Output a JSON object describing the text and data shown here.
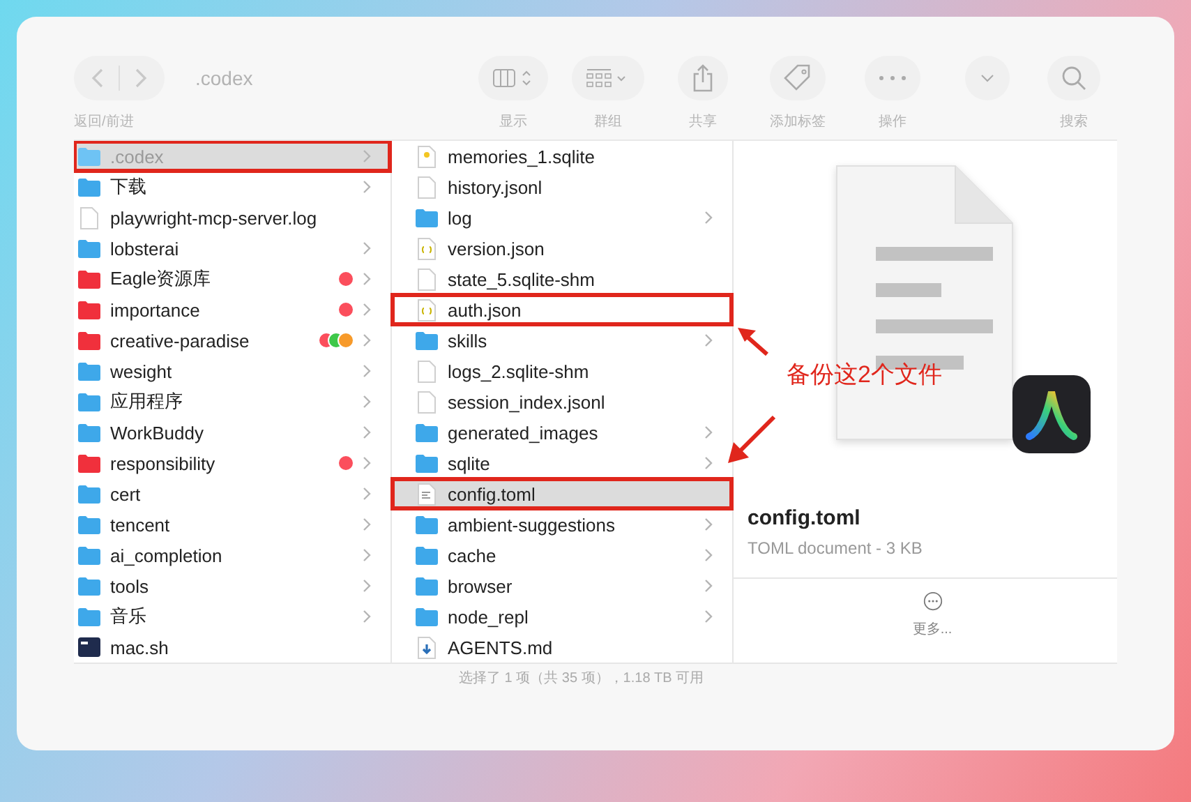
{
  "window": {
    "title": ".codex",
    "nav_label": "返回/前进"
  },
  "toolbar": [
    {
      "kind": "view",
      "label": "显示"
    },
    {
      "kind": "group",
      "label": "群组"
    },
    {
      "kind": "share",
      "label": "共享"
    },
    {
      "kind": "tag",
      "label": "添加标签"
    },
    {
      "kind": "action",
      "label": "操作"
    },
    {
      "kind": "more"
    },
    {
      "kind": "search",
      "label": "搜索"
    }
  ],
  "column_1": [
    {
      "name": ".codex",
      "kind": "folder",
      "color": "#6ec3f4",
      "selected": true,
      "highlighted": true,
      "has_children": true
    },
    {
      "name": "下载",
      "kind": "folder",
      "color": "#3ea8ea",
      "selected": false,
      "highlighted": false,
      "has_children": true
    },
    {
      "name": "playwright-mcp-server.log",
      "kind": "file",
      "selected": false,
      "highlighted": false,
      "has_children": false
    },
    {
      "name": "lobsterai",
      "kind": "folder",
      "color": "#3ea8ea",
      "selected": false,
      "highlighted": false,
      "has_children": true
    },
    {
      "name": "Eagle资源库",
      "kind": "folder",
      "color": "#f0303c",
      "selected": false,
      "highlighted": false,
      "has_children": true,
      "tags": [
        {
          "color": "#fb4e5c"
        }
      ]
    },
    {
      "name": "importance",
      "kind": "folder",
      "color": "#f0303c",
      "selected": false,
      "highlighted": false,
      "has_children": true,
      "tags": [
        {
          "color": "#fb4e5c"
        }
      ]
    },
    {
      "name": "creative-paradise",
      "kind": "folder",
      "color": "#f0303c",
      "selected": false,
      "highlighted": false,
      "has_children": true,
      "tags": [
        {
          "color": "#fb4e5c"
        },
        {
          "color": "#3ec84a"
        },
        {
          "color": "#f79a2a"
        }
      ]
    },
    {
      "name": "wesight",
      "kind": "folder",
      "color": "#3ea8ea",
      "selected": false,
      "highlighted": false,
      "has_children": true
    },
    {
      "name": "应用程序",
      "kind": "folder",
      "color": "#3ea8ea",
      "selected": false,
      "highlighted": false,
      "has_children": true
    },
    {
      "name": "WorkBuddy",
      "kind": "folder",
      "color": "#3ea8ea",
      "selected": false,
      "highlighted": false,
      "has_children": true
    },
    {
      "name": "responsibility",
      "kind": "folder",
      "color": "#f0303c",
      "selected": false,
      "highlighted": false,
      "has_children": true,
      "tags": [
        {
          "color": "#fb4e5c"
        }
      ]
    },
    {
      "name": "cert",
      "kind": "folder",
      "color": "#3ea8ea",
      "selected": false,
      "highlighted": false,
      "has_children": true
    },
    {
      "name": "tencent",
      "kind": "folder",
      "color": "#3ea8ea",
      "selected": false,
      "highlighted": false,
      "has_children": true
    },
    {
      "name": "ai_completion",
      "kind": "folder",
      "color": "#3ea8ea",
      "selected": false,
      "highlighted": false,
      "has_children": true
    },
    {
      "name": "tools",
      "kind": "folder",
      "color": "#3ea8ea",
      "selected": false,
      "highlighted": false,
      "has_children": true
    },
    {
      "name": "音乐",
      "kind": "folder",
      "color": "#3ea8ea",
      "selected": false,
      "highlighted": false,
      "has_children": true
    },
    {
      "name": "mac.sh",
      "kind": "script",
      "selected": false,
      "highlighted": false,
      "has_children": false
    }
  ],
  "column_2": [
    {
      "name": "memories_1.sqlite",
      "kind": "database",
      "selected": false,
      "highlighted": false,
      "has_children": false
    },
    {
      "name": "history.jsonl",
      "kind": "file",
      "selected": false,
      "highlighted": false,
      "has_children": false
    },
    {
      "name": "log",
      "kind": "folder",
      "color": "#3ea8ea",
      "selected": false,
      "highlighted": false,
      "has_children": true
    },
    {
      "name": "version.json",
      "kind": "json",
      "selected": false,
      "highlighted": false,
      "has_children": false
    },
    {
      "name": "state_5.sqlite-shm",
      "kind": "file",
      "selected": false,
      "highlighted": false,
      "has_children": false
    },
    {
      "name": "auth.json",
      "kind": "json",
      "selected": false,
      "highlighted": true,
      "has_children": false
    },
    {
      "name": "skills",
      "kind": "folder",
      "color": "#3ea8ea",
      "selected": false,
      "highlighted": false,
      "has_children": true
    },
    {
      "name": "logs_2.sqlite-shm",
      "kind": "file",
      "selected": false,
      "highlighted": false,
      "has_children": false
    },
    {
      "name": "session_index.jsonl",
      "kind": "file",
      "selected": false,
      "highlighted": false,
      "has_children": false
    },
    {
      "name": "generated_images",
      "kind": "folder",
      "color": "#3ea8ea",
      "selected": false,
      "highlighted": false,
      "has_children": true
    },
    {
      "name": "sqlite",
      "kind": "folder",
      "color": "#3ea8ea",
      "selected": false,
      "highlighted": false,
      "has_children": true
    },
    {
      "name": "config.toml",
      "kind": "text",
      "selected": true,
      "highlighted": true,
      "has_children": false
    },
    {
      "name": "ambient-suggestions",
      "kind": "folder",
      "color": "#3ea8ea",
      "selected": false,
      "highlighted": false,
      "has_children": true
    },
    {
      "name": "cache",
      "kind": "folder",
      "color": "#3ea8ea",
      "selected": false,
      "highlighted": false,
      "has_children": true
    },
    {
      "name": "browser",
      "kind": "folder",
      "color": "#3ea8ea",
      "selected": false,
      "highlighted": false,
      "has_children": true
    },
    {
      "name": "node_repl",
      "kind": "folder",
      "color": "#3ea8ea",
      "selected": false,
      "highlighted": false,
      "has_children": true
    },
    {
      "name": "AGENTS.md",
      "kind": "markdown",
      "selected": false,
      "highlighted": false,
      "has_children": false
    }
  ],
  "preview": {
    "file_name": "config.toml",
    "file_info": "TOML document - 3 KB",
    "more_label": "更多..."
  },
  "annotation": {
    "text": "备份这2个文件"
  },
  "status_bar": "选择了 1 项（共 35 项），1.18 TB 可用"
}
